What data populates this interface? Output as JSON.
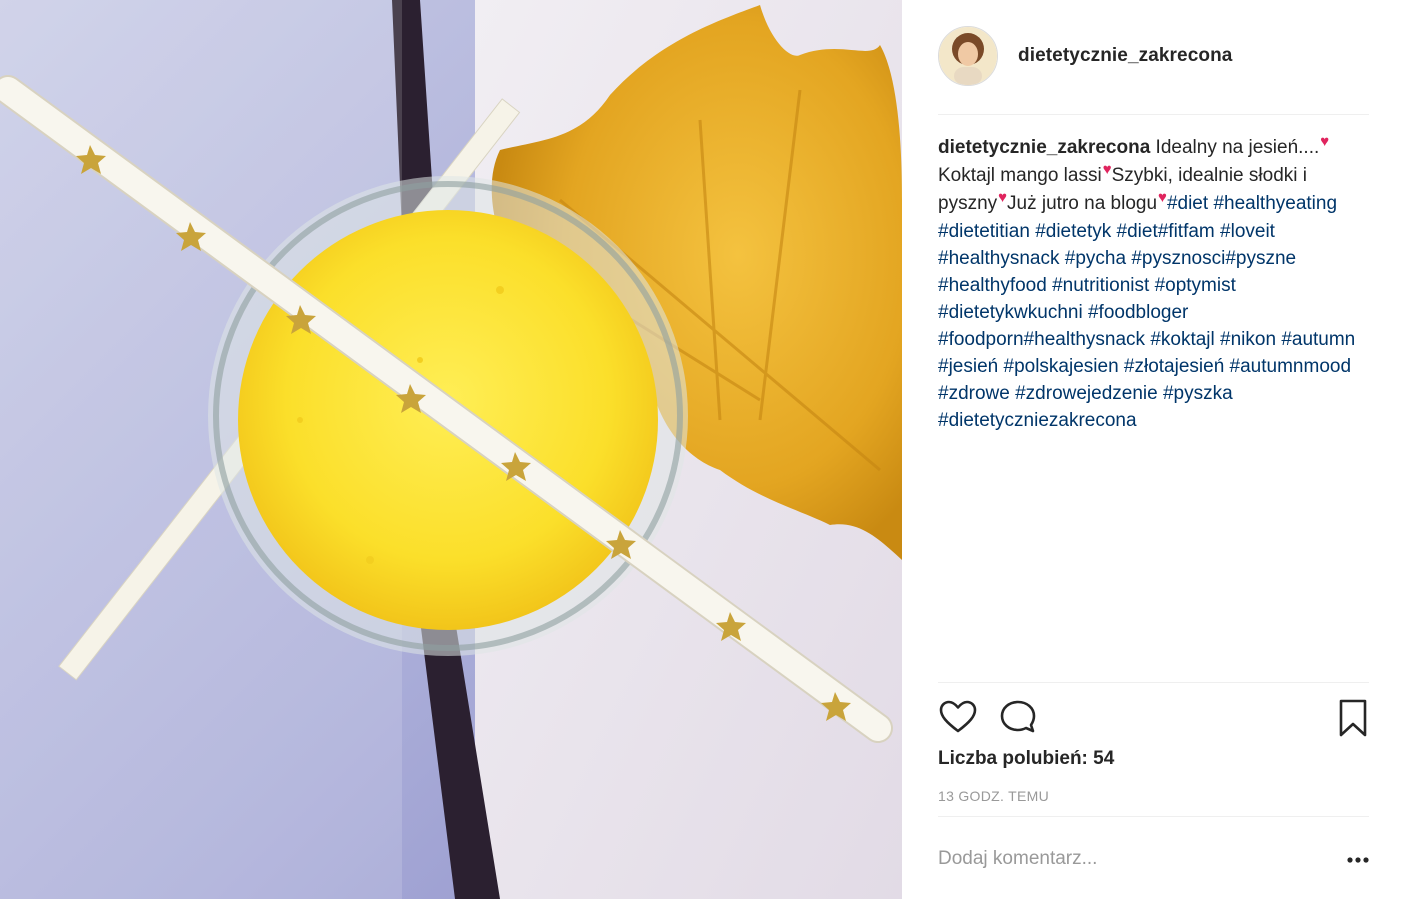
{
  "post": {
    "username": "dietetycznie_zakrecona",
    "caption": {
      "username": "dietetycznie_zakrecona",
      "text_1": "Idealny na jesień....",
      "text_2": "Koktajl mango lassi",
      "text_3": "Szybki, idealnie słodki i pyszny",
      "text_4": "Już jutro na blogu",
      "heart": "♥",
      "hashtags": [
        "#diet",
        "#healthyeating",
        "#dietetitian",
        "#dietetyk",
        "#diet",
        "#fitfam",
        "#loveit",
        "#healthysnack",
        "#pycha",
        "#pysznosci",
        "#pyszne",
        "#healthyfood",
        "#nutritionist",
        "#optymist",
        "#dietetykwkuchni",
        "#foodbloger",
        "#foodporn",
        "#healthysnack",
        "#koktajl",
        "#nikon",
        "#autumn",
        "#jesień",
        "#polskajesien",
        "#złotajesień",
        "#autumnmood",
        "#zdrowe",
        "#zdrowejedzenie",
        "#pyszka",
        "#dietetyczniezakrecona"
      ]
    },
    "likes_text": "Liczba polubień: 54",
    "timestamp": "13 GODZ. TEMU",
    "comment_placeholder": "Dodaj komentarz...",
    "icons": {
      "like": "heart-outline-icon",
      "comment": "comment-bubble-icon",
      "save": "bookmark-icon",
      "more": "more-dots-icon"
    },
    "colors": {
      "hashtag": "#003569",
      "text": "#262626",
      "muted": "#999999",
      "divider": "#efefef",
      "emoji_heart": "#e0245e"
    }
  }
}
